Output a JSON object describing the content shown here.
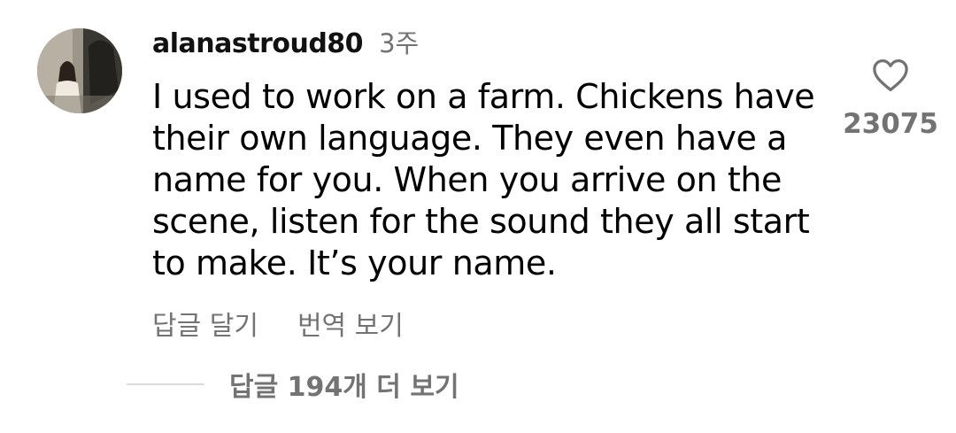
{
  "comment": {
    "avatar_icon": "profile-photo-avatar",
    "username": "alanastroud80",
    "time_ago": "3주",
    "text": "I used to work on a farm. Chickens have their own language. They even have a name for you. When you arrive on the scene, listen for the sound they all start to make. It’s your name.",
    "reply_label": "답글 달기",
    "translate_label": "번역 보기",
    "like_icon": "heart-outline-icon",
    "like_count": "23075"
  },
  "replies": {
    "label": "답글 194개 더 보기"
  },
  "colors": {
    "text_primary": "#000000",
    "text_secondary": "#737373",
    "divider": "#dbdbdb",
    "background": "#ffffff"
  }
}
